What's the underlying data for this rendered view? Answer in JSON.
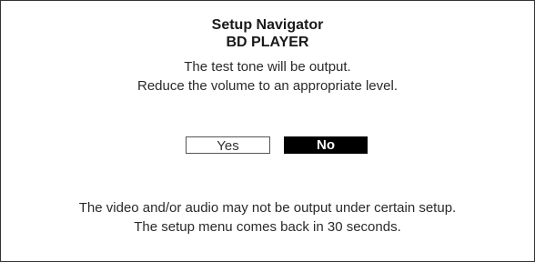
{
  "dialog": {
    "title": "Setup Navigator",
    "subtitle": "BD PLAYER",
    "message_line1": "The test tone will be output.",
    "message_line2": "Reduce the volume to an appropriate level.",
    "buttons": {
      "yes_label": "Yes",
      "no_label": "No",
      "selected": "No"
    },
    "note_line1": "The video and/or audio may not be output under certain setup.",
    "note_line2": "The setup menu comes back in 30 seconds."
  },
  "colors": {
    "background": "#ffffff",
    "text": "#1a1a1a",
    "selected_button_bg": "#000000",
    "selected_button_text": "#ffffff"
  }
}
